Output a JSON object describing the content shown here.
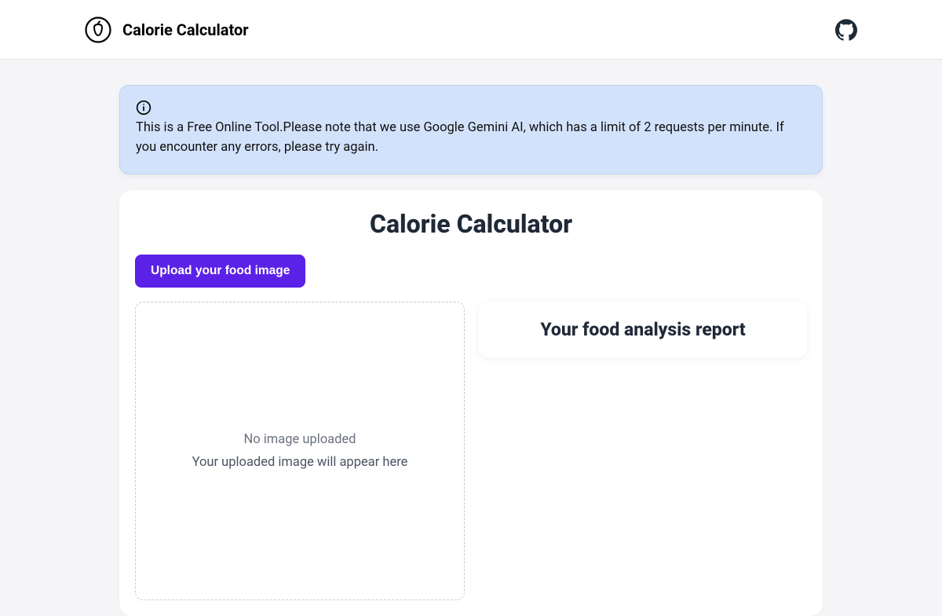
{
  "header": {
    "title": "Calorie Calculator"
  },
  "info": {
    "text": "This is a Free Online Tool.Please note that we use Google Gemini AI, which has a limit of 2 requests per minute. If you encounter any errors, please try again."
  },
  "main": {
    "title": "Calorie Calculator",
    "upload_label": "Upload your food image",
    "dropzone": {
      "title": "No image uploaded",
      "subtitle": "Your uploaded image will appear here"
    },
    "report_title": "Your food analysis report"
  },
  "colors": {
    "accent": "#5b21e6",
    "info_bg": "#d3e2fb"
  }
}
